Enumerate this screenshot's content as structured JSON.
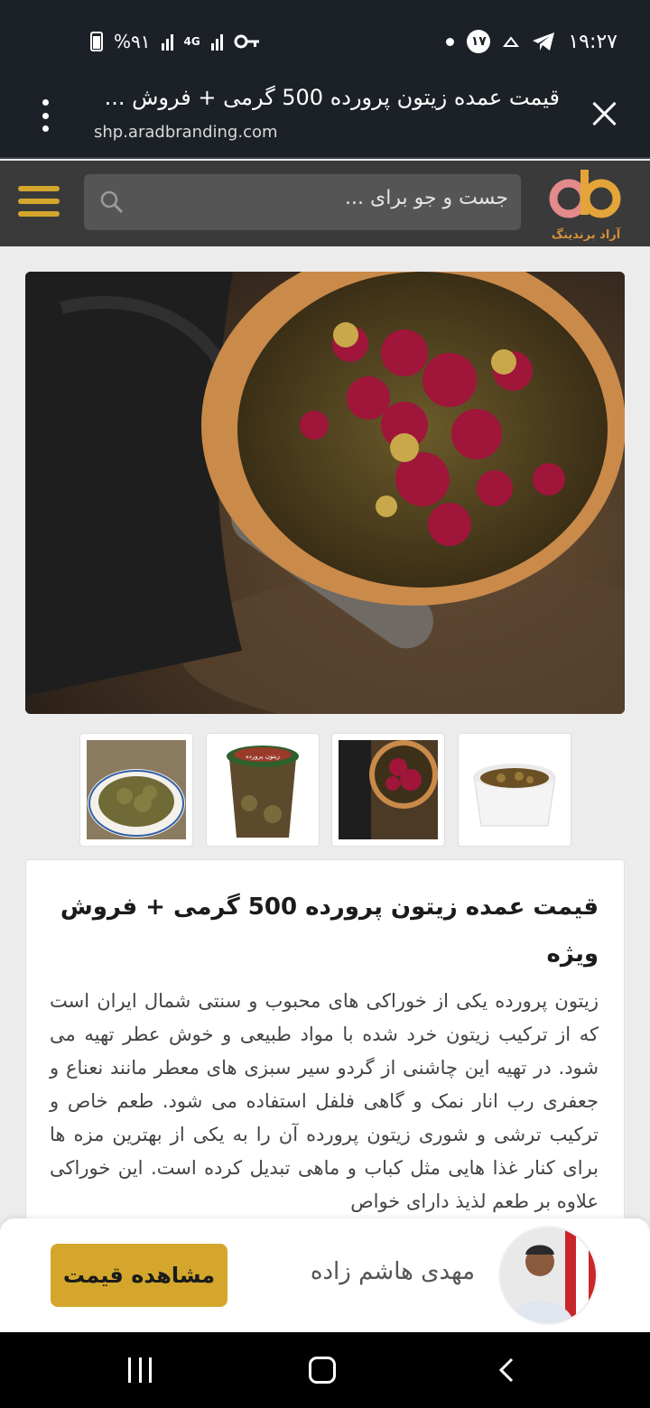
{
  "status_bar": {
    "time": "۱۹:۲۷",
    "notification_count": "۱۷",
    "battery": "%۹۱",
    "network": "4G"
  },
  "tab": {
    "title": "قیمت عمده زیتون پرورده 500 گرمی + فروش ...",
    "url": "shp.aradbranding.com"
  },
  "header": {
    "search_placeholder": "جست و جو برای ...",
    "logo_text": "آراد برندینگ",
    "accent_color": "#d4a72c"
  },
  "product": {
    "title": "قیمت عمده زیتون پرورده 500 گرمی + فروش ویژه",
    "description": "زیتون پرورده یکی از خوراکی های محبوب و سنتی شمال ایران است که از ترکیب زیتون خرد شده با مواد طبیعی و خوش عطر تهیه می شود. در تهیه این چاشنی از گردو سیر سبزی های معطر مانند نعناع و جعفری رب انار نمک و گاهی فلفل استفاده می شود. طعم خاص و ترکیب ترشی و شوری زیتون پرورده آن را به یکی از بهترین مزه ها برای کنار غذا هایی مثل کباب و ماهی تبدیل کرده است. این خوراکی علاوه بر طعم لذیذ دارای خواص"
  },
  "thumb_label": "زیتون پرورده",
  "contact": {
    "seller_name": "مهدی هاشم زاده",
    "price_button": "مشاهده قیمت"
  }
}
